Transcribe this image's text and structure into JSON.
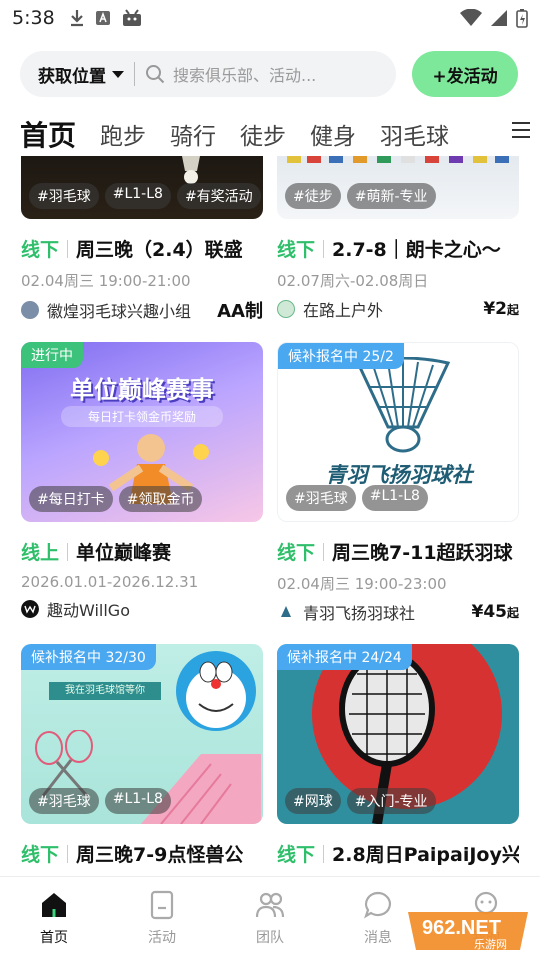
{
  "status_bar": {
    "time": "5:38"
  },
  "search": {
    "location_label": "获取位置",
    "placeholder": "搜索俱乐部、活动..."
  },
  "post_button_label": "+发活动",
  "tabs": [
    {
      "label": "首页",
      "active": true
    },
    {
      "label": "跑步"
    },
    {
      "label": "骑行"
    },
    {
      "label": "徒步"
    },
    {
      "label": "健身"
    },
    {
      "label": "羽毛球"
    }
  ],
  "cards": [
    {
      "mode": "线下",
      "title": "周三晚（2.4）联盛",
      "date": "02.04周三 19:00-21:00",
      "org": "徽煌羽毛球兴趣小组",
      "fee": "AA制",
      "tags": [
        "#羽毛球",
        "#L1-L8",
        "#有奖活动"
      ]
    },
    {
      "mode": "线下",
      "title": "2.7-8｜朗卡之心〜",
      "date": "02.07周六-02.08周日",
      "org": "在路上户外",
      "price": "¥2",
      "price_suffix": "起",
      "tags": [
        "#徒步",
        "#萌新-专业"
      ]
    },
    {
      "status": "进行中",
      "mode": "线上",
      "title": "单位巅峰赛",
      "date": "2026.01.01-2026.12.31",
      "org": "趣动WillGo",
      "banner_title": "单位巅峰赛事",
      "banner_sub": "每日打卡领金币奖励",
      "tags": [
        "#每日打卡",
        "#领取金币"
      ]
    },
    {
      "status": "候补报名中 25/2",
      "mode": "线下",
      "title": "周三晚7-11超跃羽球",
      "date": "02.04周三 19:00-23:00",
      "org": "青羽飞扬羽球社",
      "price": "¥45",
      "price_suffix": "起",
      "banner_title": "青羽飞扬羽球社",
      "tags": [
        "#羽毛球",
        "#L1-L8"
      ]
    },
    {
      "status": "候补报名中 32/30",
      "mode": "线下",
      "title": "周三晚7-9点怪兽公",
      "banner_title": "我在羽毛球馆等你",
      "tags": [
        "#羽毛球",
        "#L1-L8"
      ]
    },
    {
      "status": "候补报名中 24/24",
      "mode": "线下",
      "title": "2.8周日PaipaiJoy兴",
      "tags": [
        "#网球",
        "#入门-专业"
      ]
    }
  ],
  "bottom_nav": [
    {
      "label": "首页",
      "icon": "home-icon",
      "active": true
    },
    {
      "label": "活动",
      "icon": "activity-icon"
    },
    {
      "label": "团队",
      "icon": "team-icon"
    },
    {
      "label": "消息",
      "icon": "message-icon"
    },
    {
      "label": "我的",
      "icon": "profile-icon"
    }
  ],
  "watermark": {
    "brand": "962.NET",
    "sub": "乐游网"
  },
  "colors": {
    "accent_green": "#2fbf6b",
    "button_green": "#7ee89a",
    "waitlist_blue": "#4aa8f0",
    "ongoing_green": "#3cc27a"
  }
}
